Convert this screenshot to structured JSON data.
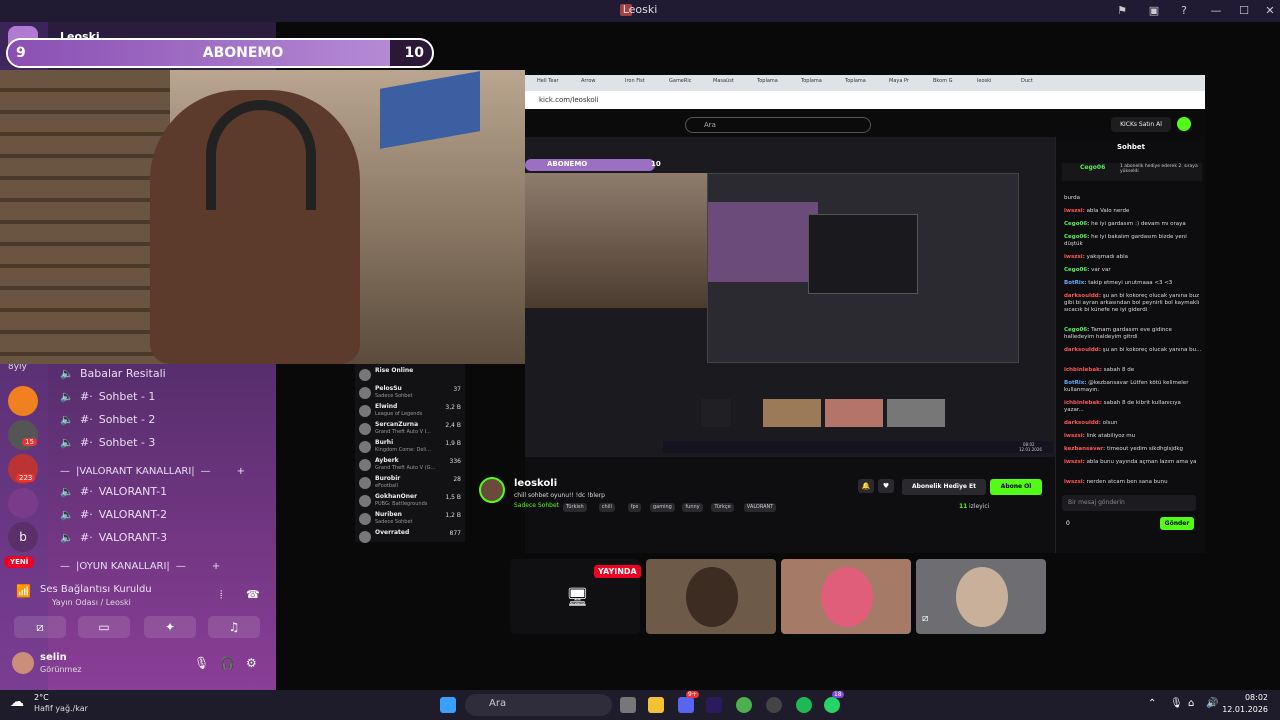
{
  "window": {
    "title": "Leoski"
  },
  "discord": {
    "server_name": "Leoski",
    "online_stub": "8yly",
    "voice_channels": [
      {
        "label": "Babalar Resitali"
      },
      {
        "label": "Sohbet - 1"
      },
      {
        "label": "Sohbet - 2"
      },
      {
        "label": "Sohbet - 3"
      }
    ],
    "category_valorant": "|VALORANT KANALLARI|",
    "valorant_channels": [
      "VALORANT-1",
      "VALORANT-2",
      "VALORANT-3"
    ],
    "category_oyun": "|OYUN KANALLARI|",
    "badges": {
      "server2": "15",
      "server3": "223",
      "yeni": "YENİ",
      "letter": "b"
    },
    "voice_status": {
      "title": "Ses Bağlantısı Kuruldu",
      "subtitle": "Yayın Odası / Leoski"
    },
    "user": {
      "name": "selin",
      "status": "Görünmez"
    }
  },
  "overlay": {
    "abone_left": "9",
    "abone_label": "ABONEMO",
    "abone_right": "10",
    "abone_progress": 0.9
  },
  "browser": {
    "tabs": [
      "Hell Tear",
      "Arrow",
      "Iron Fist",
      "GameRic",
      "Masaüst",
      "Toplama",
      "Toplama",
      "Toplama",
      "Maya Pr",
      "Bkom G",
      "leoski",
      "Duct"
    ],
    "url": "kick.com/leoskoli",
    "search_placeholder": "Ara",
    "kicks_button": "KICKs Satın Al",
    "chat_title": "Sohbet",
    "gift_user": "Cego06",
    "gift_text": "1 abonelik hediye ederek 2. sıraya yükseldi",
    "chat_messages": [
      {
        "user": "",
        "text": "burda"
      },
      {
        "user": "iwszsi:",
        "text": "abla Valo nerde"
      },
      {
        "user": "Cego06:",
        "text": "he iyi gardasım :) devam mı oraya"
      },
      {
        "user": "Cego06:",
        "text": "he iyi bakalım gardasım bizde yeni düştük"
      },
      {
        "user": "iwszsi:",
        "text": "yakışmadı abla"
      },
      {
        "user": "Cego06:",
        "text": "var var"
      },
      {
        "user": "BotRix:",
        "text": "takip etmeyi unutmaaa <3 <3"
      },
      {
        "user": "darksouldd:",
        "text": "şu an bi kokoreç olucak yanına buz gibi bi ayran arkasından bol peynirli bol kaymaklı sıcacık bi künefe ne iyi giderdi"
      },
      {
        "user": "Cego06:",
        "text": "Tamam gardasım eve gidince halledeyim haldeyim gitrdi"
      },
      {
        "user": "darksouldd:",
        "text": "şu an bi kokoreç olucak yanına bu..."
      },
      {
        "user": "ichbinlebak:",
        "text": "sabah 8 de"
      },
      {
        "user": "BotRix:",
        "text": "@kezbansavar Lütfen kötü kelimeler kullanmayın."
      },
      {
        "user": "ichbinlebak:",
        "text": "sabah 8 de kibrit kullanıcıya yazar..."
      },
      {
        "user": "darksouldd:",
        "text": "olsun"
      },
      {
        "user": "iwszsi:",
        "text": "link atabiliyoz mu"
      },
      {
        "user": "kezbansavar:",
        "text": "timeout yedim sikdhglsjdkg"
      },
      {
        "user": "iwszsi:",
        "text": "abla bunu yayında açman lazım ama ya"
      },
      {
        "user": "iwszsi:",
        "text": "nerden atcam ben sana bunu"
      }
    ],
    "chat_placeholder": "Bir mesaj gönderin",
    "send_label": "Gönder",
    "chat_count": "0",
    "streamer": {
      "name": "leoskoli",
      "title": "chill sohbet oyunu!! !dc !blerp",
      "category": "Sadece Sohbet",
      "tags": [
        "Türkish",
        "chill",
        "fps",
        "gaming",
        "funny",
        "Türkçe",
        "VALORANT"
      ],
      "gift_button": "Abonelik Hediye Et",
      "sub_button": "Abone Ol",
      "viewers": "11",
      "viewers_label": "izleyici"
    },
    "inner_abone_label": "ABONEMO",
    "inner_abone_right": "10",
    "clock_time": "08:02",
    "clock_date": "12.01.2026"
  },
  "following": [
    {
      "name": "Rise Online",
      "game": "",
      "viewers": ""
    },
    {
      "name": "PelosSu",
      "game": "Sadece Sohbet",
      "viewers": "37"
    },
    {
      "name": "Elwind",
      "game": "League of Legends",
      "viewers": "3,2 B"
    },
    {
      "name": "SercanZurna",
      "game": "Grand Theft Auto V I...",
      "viewers": "2,4 B"
    },
    {
      "name": "Burhi",
      "game": "Kingdom Come: Deli...",
      "viewers": "1,9 B"
    },
    {
      "name": "Ayberk",
      "game": "Grand Theft Auto V (G...",
      "viewers": "336"
    },
    {
      "name": "Burobir",
      "game": "eFootball",
      "viewers": "28"
    },
    {
      "name": "GokhanOner",
      "game": "PUBG: Battlegrounds",
      "viewers": "1,5 B"
    },
    {
      "name": "Nuriben",
      "game": "Sadece Sohbet",
      "viewers": "1,2 B"
    },
    {
      "name": "Overrated",
      "game": "",
      "viewers": "877"
    }
  ],
  "call": {
    "live_badge": "YAYINDA"
  },
  "taskbar": {
    "weather_temp": "2°C",
    "weather_desc": "Hafif yağ./kar",
    "search_label": "Ara",
    "time": "08:02",
    "date": "12.01.2026",
    "discord_badge": "9+",
    "whatsapp_badge": "18"
  }
}
